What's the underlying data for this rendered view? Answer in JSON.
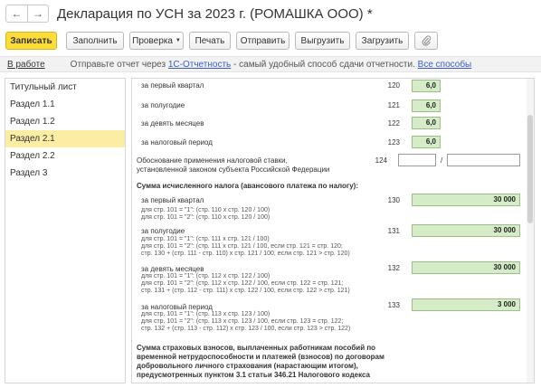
{
  "window": {
    "back_glyph": "←",
    "forward_glyph": "→",
    "title": "Декларация по УСН за 2023 г. (РОМАШКА ООО) *"
  },
  "toolbar": {
    "save": "Записать",
    "fill": "Заполнить",
    "check": "Проверка",
    "print": "Печать",
    "send": "Отправить",
    "export": "Выгрузить",
    "import": "Загрузить",
    "attach_icon": "paperclip-icon",
    "accent_color": "#fcdc3b"
  },
  "infobar": {
    "status": "В работе",
    "text_before": "Отправьте отчет через ",
    "link1": "1С-Отчетность",
    "text_middle": " - самый удобный способ сдачи отчетности. ",
    "link2": "Все способы"
  },
  "sidebar": {
    "items": [
      "Титульный лист",
      "Раздел 1.1",
      "Раздел 1.2",
      "Раздел 2.1",
      "Раздел 2.2",
      "Раздел 3"
    ],
    "selected": "Раздел 2.1"
  },
  "form": {
    "rate_rows": [
      {
        "label": "за первый квартал",
        "code": "120",
        "value": "6,0"
      },
      {
        "label": "за полугодие",
        "code": "121",
        "value": "6,0"
      },
      {
        "label": "за девять месяцев",
        "code": "122",
        "value": "6,0"
      },
      {
        "label": "за налоговый период",
        "code": "123",
        "value": "6,0"
      }
    ],
    "justification": {
      "line1": "Обоснование применения налоговой ставки,",
      "line2": "установленной законом субъекта Российской Федерации",
      "code": "124",
      "separator": "/",
      "value1": "",
      "value2": ""
    },
    "tax_heading": "Сумма исчисленного налога (авансового платежа по налогу):",
    "tax_rows": [
      {
        "label": "за первый квартал",
        "code": "130",
        "value": "30 000",
        "formulas": [
          "для стр. 101 = \"1\": (стр. 110 x стр. 120 / 100)",
          "для стр. 101 = \"2\": (стр. 110 x стр. 120 / 100)"
        ]
      },
      {
        "label": "за полугодие",
        "code": "131",
        "value": "30 000",
        "formulas": [
          "для стр. 101 = \"1\": (стр. 111 x стр. 121 / 100)",
          "для стр. 101 = \"2\": (стр. 111 x стр. 121 / 100, если стр. 121 = стр. 120;",
          "стр. 130 + (стр. 111 - стр. 110) x стр. 121 / 100, если стр. 121 > стр. 120)"
        ]
      },
      {
        "label": "за девять месяцев",
        "code": "132",
        "value": "30 000",
        "formulas": [
          "для стр. 101 = \"1\": (стр. 112 x стр. 122 / 100)",
          "для стр. 101 = \"2\": (стр. 112 x стр. 122 / 100, если стр. 122 = стр. 121;",
          "стр. 131 + (стр. 112 - стр. 111) x стр. 122 / 100, если стр. 122 > стр. 121)"
        ]
      },
      {
        "label": "за налоговый период",
        "code": "133",
        "value": "3 000",
        "formulas": [
          "для стр. 101 = \"1\": (стр. 113 x стр. 123 / 100)",
          "для стр. 101 = \"2\": (стр. 113 x стр. 123 / 100, если стр. 123 = стр. 122;",
          "стр. 132 + (стр. 113 - стр. 112) x стр. 123 / 100, если стр. 123 > стр. 122)"
        ]
      }
    ],
    "insurance_heading": [
      "Сумма страховых взносов, выплаченных работникам пособий по",
      "временной нетрудоспособности и платежей (взносов) по договорам",
      "добровольного личного страхования (нарастающим итогом),",
      "предусмотренных пунктом 3.1 статьи 346.21 Налогового кодекса"
    ]
  }
}
